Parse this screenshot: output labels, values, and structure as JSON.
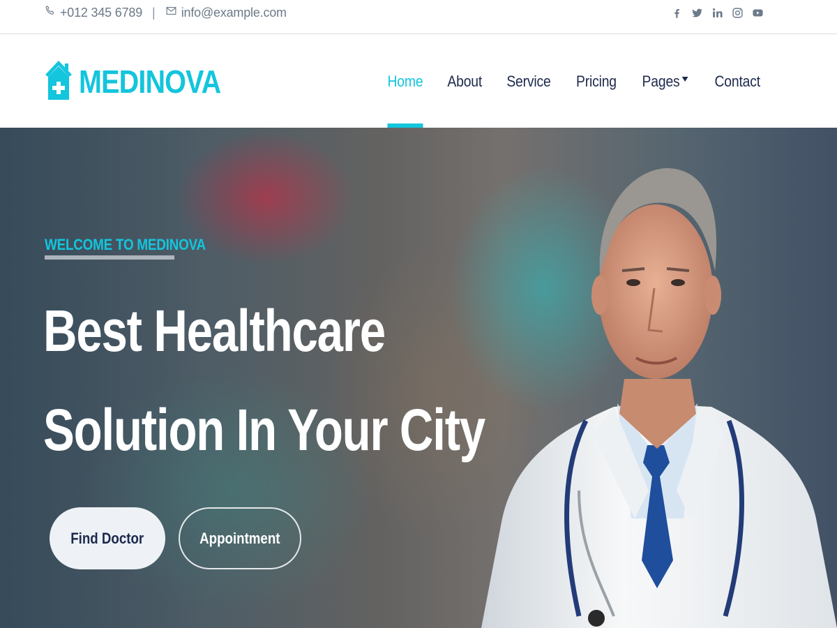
{
  "topbar": {
    "phone": "+012 345 6789",
    "separator": "|",
    "email": "info@example.com",
    "social": [
      "facebook-icon",
      "twitter-icon",
      "linkedin-icon",
      "instagram-icon",
      "youtube-icon"
    ]
  },
  "brand": {
    "name": "MEDINOVA",
    "color": "#13c5dd"
  },
  "nav": {
    "items": [
      "Home",
      "About",
      "Service",
      "Pricing",
      "Pages",
      "Contact"
    ],
    "active": "Home"
  },
  "hero": {
    "eyebrow": "WELCOME TO MEDINOVA",
    "headline_line1": "Best Healthcare",
    "headline_line2": "Solution In Your City",
    "btn_primary": "Find Doctor",
    "btn_secondary": "Appointment"
  },
  "colors": {
    "accent": "#13c5dd",
    "dark": "#1d2a4d",
    "muted": "#6c7a89"
  }
}
